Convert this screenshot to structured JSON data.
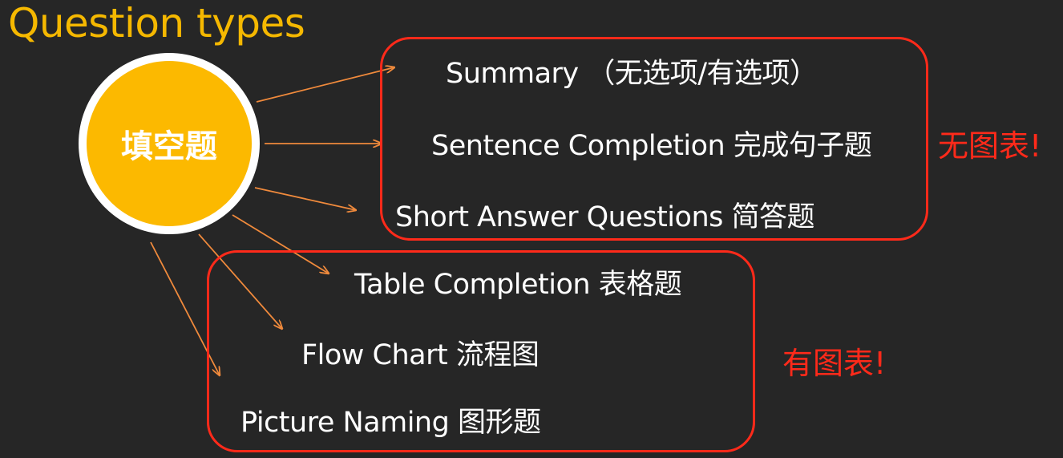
{
  "page_title": "Question types",
  "center_node": {
    "label": "填空题"
  },
  "groups": [
    {
      "tag": "无图表!",
      "items": [
        "Summary （无选项/有选项）",
        "Sentence Completion 完成句子题",
        "Short  Answer Questions 简答题"
      ]
    },
    {
      "tag": "有图表!",
      "items": [
        "Table Completion 表格题",
        "Flow Chart 流程图",
        "Picture Naming 图形题"
      ]
    }
  ],
  "colors": {
    "background": "#262626",
    "title": "#f5b800",
    "circle_fill": "#fcb900",
    "circle_border": "#ffffff",
    "group_border": "#ff2a1a",
    "tag_text": "#ff2a1a",
    "arrow": "#f08a3c",
    "item_text": "#ffffff"
  }
}
